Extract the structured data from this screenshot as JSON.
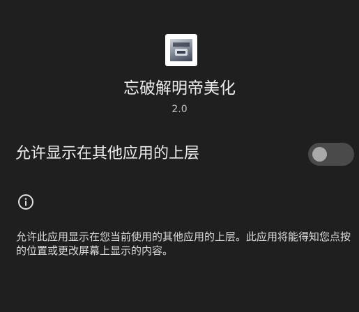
{
  "app": {
    "icon": "app-logo-icon",
    "name": "忘破解明帝美化",
    "version": "2.0"
  },
  "permission": {
    "label": "允许显示在其他应用的上层",
    "enabled": false,
    "toggle_color_off": "#4a4a4a",
    "knob_color_off": "#a9a9a9"
  },
  "info": {
    "icon": "info-icon",
    "description": "允许此应用显示在您当前使用的其他应用的上层。此应用将能得知您点按的位置或更改屏幕上显示的内容。"
  },
  "colors": {
    "background": "#1f1f1f",
    "text_primary": "#ececec",
    "text_secondary": "#c4c4c4"
  }
}
